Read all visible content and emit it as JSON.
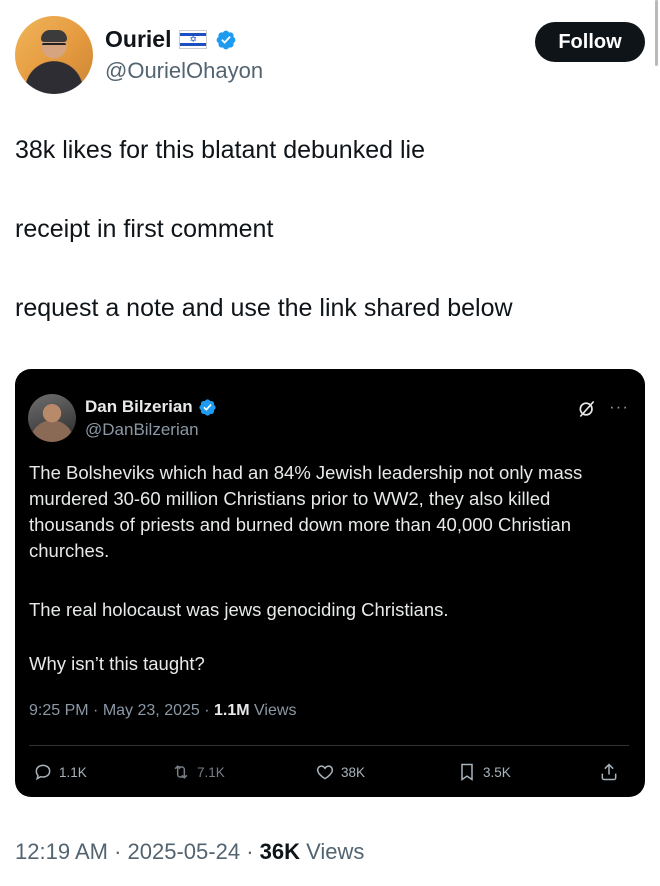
{
  "author": {
    "name": "Ouriel",
    "handle": "@OurielOhayon",
    "follow_label": "Follow"
  },
  "tweet": {
    "lines": [
      "38k likes for this blatant debunked lie",
      "receipt in first comment",
      "request a note and use the link shared below"
    ],
    "time": "12:19 AM",
    "date": "2025-05-24",
    "views_count": "36K",
    "views_label": "Views"
  },
  "quoted": {
    "name": "Dan Bilzerian",
    "handle": "@DanBilzerian",
    "more": "···",
    "paragraphs": [
      "The Bolsheviks which had an 84% Jewish leadership not only mass murdered 30-60 million Christians prior to WW2, they also killed thousands of priests and burned down more than 40,000 Christian churches.",
      "The real holocaust was jews genociding Christians.",
      "Why isn’t this taught?"
    ],
    "time": "9:25 PM",
    "date": "May 23, 2025",
    "views_count": "1.1M",
    "views_label": "Views",
    "actions": {
      "replies": "1.1K",
      "reposts": "7.1K",
      "likes": "38K",
      "bookmarks": "3.5K"
    }
  },
  "colors": {
    "verified": "#1d9bf0",
    "follow_bg": "#0f1419",
    "embed_bg": "#000000"
  },
  "icons": [
    "verified-badge-icon",
    "israel-flag-icon",
    "grok-icon",
    "more-icon",
    "reply-icon",
    "repost-icon",
    "like-icon",
    "bookmark-icon",
    "share-icon"
  ]
}
